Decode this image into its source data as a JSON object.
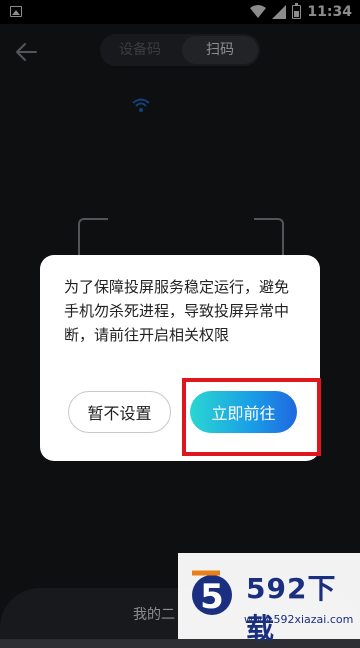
{
  "status_bar": {
    "time": "11:34"
  },
  "header": {
    "tabs": [
      {
        "label": "设备码",
        "active": false
      },
      {
        "label": "扫码",
        "active": true
      }
    ]
  },
  "bottom_sheet": {
    "label": "我的二"
  },
  "dialog": {
    "message": "为了保障投屏服务稳定运行，避免手机勿杀死进程，导致投屏异常中断，请前往开启相关权限",
    "cancel_label": "暂不设置",
    "confirm_label": "立即前往"
  },
  "watermark": {
    "brand": "592下载",
    "url": "www.592xiazai.com",
    "badge_digit": "5"
  },
  "colors": {
    "accent_gradient_start": "#2ad6d2",
    "accent_gradient_end": "#1f68e0",
    "highlight_box": "#e0161e",
    "background": "#1a1c20"
  }
}
